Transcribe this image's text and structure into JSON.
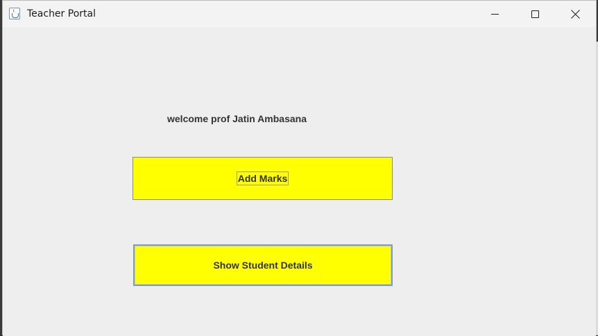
{
  "window": {
    "title": "Teacher Portal",
    "icon": "java-cup-icon"
  },
  "titlebar_controls": {
    "minimize_icon": "minimize-icon",
    "maximize_icon": "maximize-icon",
    "close_icon": "close-icon"
  },
  "main": {
    "welcome_text": "welcome prof Jatin Ambasana",
    "add_marks_label": "Add Marks",
    "show_details_label": "Show Student Details"
  },
  "colors": {
    "button_background": "#ffff00",
    "window_background": "#eeeeee",
    "text": "#333333"
  }
}
